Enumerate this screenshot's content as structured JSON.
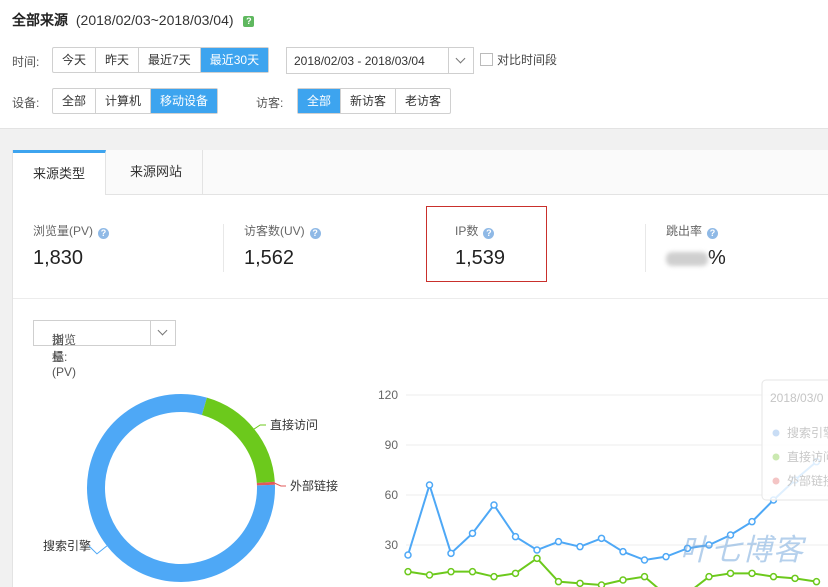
{
  "header": {
    "title": "全部来源",
    "range": "(2018/02/03~2018/03/04)",
    "help": "?"
  },
  "time": {
    "label": "时间:",
    "options": [
      "今天",
      "昨天",
      "最近7天",
      "最近30天"
    ],
    "active": 3,
    "date_range": "2018/02/03 - 2018/03/04",
    "compare_label": "对比时间段"
  },
  "device": {
    "label": "设备:",
    "options": [
      "全部",
      "计算机",
      "移动设备"
    ],
    "active": 2
  },
  "visitor": {
    "label": "访客:",
    "options": [
      "全部",
      "新访客",
      "老访客"
    ],
    "active": 0
  },
  "tabs": [
    "来源类型",
    "来源网站"
  ],
  "metrics": [
    {
      "label": "浏览量(PV)",
      "value": "1,830"
    },
    {
      "label": "访客数(UV)",
      "value": "1,562"
    },
    {
      "label": "IP数",
      "value": "1,539"
    },
    {
      "label": "跳出率",
      "value": "%"
    }
  ],
  "indicator": {
    "label": "指标:",
    "value": "浏览量(PV)"
  },
  "colors": {
    "accent": "#3da4ef",
    "blue": "#4ea8f6",
    "green": "#6cc91c",
    "red": "#e05a5a"
  },
  "chart_data": [
    {
      "type": "pie",
      "labels": [
        "搜索引擎",
        "直接访问",
        "外部链接"
      ],
      "values": [
        80,
        19.5,
        0.5
      ]
    },
    {
      "type": "line",
      "ylim": [
        0,
        120
      ],
      "yticks": [
        30,
        60,
        90,
        120
      ],
      "series": [
        {
          "name": "搜索引擎",
          "values": [
            24,
            66,
            25,
            37,
            54,
            35,
            27,
            32,
            29,
            34,
            26,
            21,
            23,
            28,
            30,
            36,
            44,
            57,
            69,
            80
          ]
        },
        {
          "name": "直接访问",
          "values": [
            14,
            12,
            14,
            14,
            11,
            13,
            22,
            8,
            7,
            6,
            9,
            11,
            0,
            1,
            11,
            13,
            13,
            11,
            10,
            8
          ]
        }
      ],
      "tooltip": {
        "title": "2018/03/0",
        "items": [
          "搜索引擎",
          "直接访问",
          "外部链接"
        ]
      }
    }
  ],
  "watermark": "叶七博客"
}
